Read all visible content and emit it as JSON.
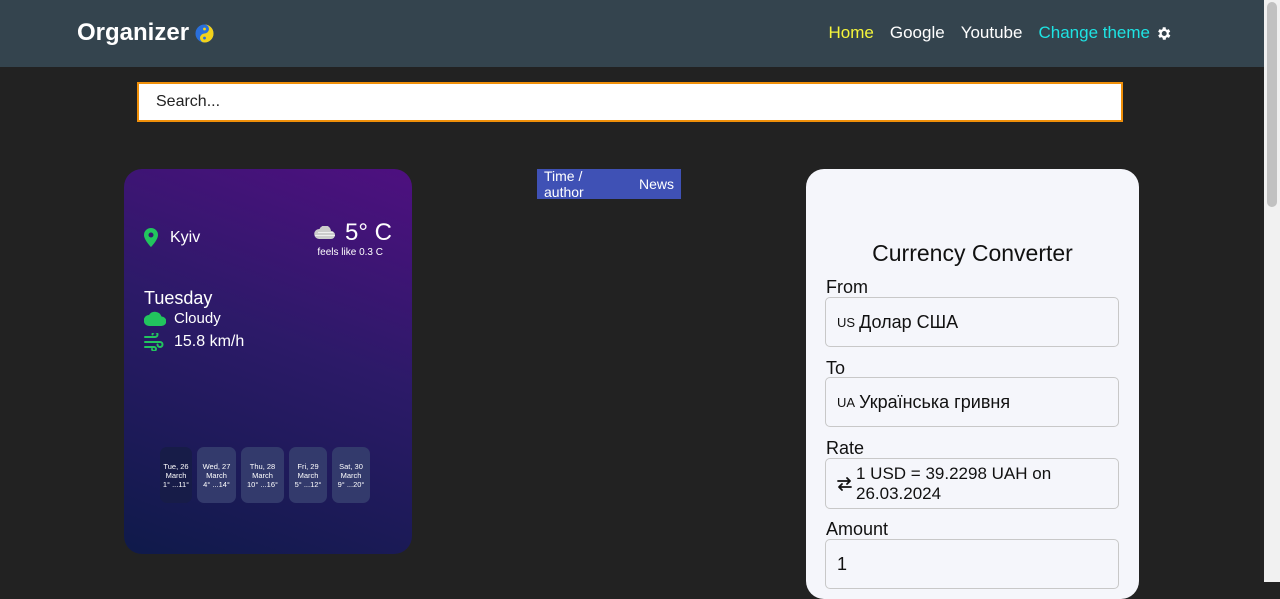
{
  "navbar": {
    "brand": "Organizer",
    "links": {
      "home": "Home",
      "google": "Google",
      "youtube": "Youtube",
      "theme": "Change theme"
    },
    "colors": {
      "bg": "#34444e",
      "home": "#f5f53b",
      "theme": "#1ee3e3"
    }
  },
  "search": {
    "placeholder": "Search..."
  },
  "weather": {
    "city": "Kyiv",
    "temperature": "5° C",
    "feels_like": "feels like 0.3 C",
    "day": "Tuesday",
    "condition": "Cloudy",
    "wind": "15.8 km/h",
    "forecast": [
      {
        "day": "Tue, 26",
        "month": "March",
        "range": "1° ...11°"
      },
      {
        "day": "Wed, 27",
        "month": "March",
        "range": "4° ...14°"
      },
      {
        "day": "Thu, 28",
        "month": "March",
        "range": "10° ...16°"
      },
      {
        "day": "Fri, 29",
        "month": "March",
        "range": "5° ...12°"
      },
      {
        "day": "Sat, 30",
        "month": "March",
        "range": "9° ...20°"
      }
    ]
  },
  "tabs": {
    "time_author": "Time / author",
    "news": "News"
  },
  "currency": {
    "title": "Currency Converter",
    "from_label": "From",
    "from_code": "US",
    "from_value": "Долар США",
    "to_label": "To",
    "to_code": "UA",
    "to_value": "Українська гривня",
    "rate_label": "Rate",
    "rate_line1": "1 USD = 39.2298 UAH on",
    "rate_line2": "26.03.2024",
    "amount_label": "Amount",
    "amount_value": "1"
  }
}
